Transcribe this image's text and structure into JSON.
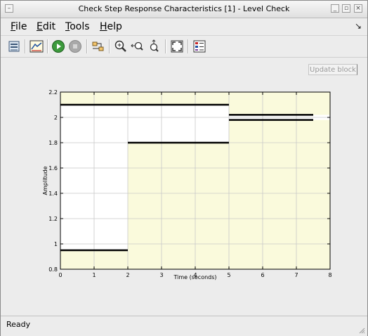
{
  "window": {
    "title": "Check Step Response Characteristics [1] - Level Check"
  },
  "menu": {
    "items": [
      {
        "label": "File",
        "mnemonic": "F",
        "rest": "ile"
      },
      {
        "label": "Edit",
        "mnemonic": "E",
        "rest": "dit"
      },
      {
        "label": "Tools",
        "mnemonic": "T",
        "rest": "ools"
      },
      {
        "label": "Help",
        "mnemonic": "H",
        "rest": "elp"
      }
    ],
    "dock_arrow": "↘"
  },
  "toolbar": {
    "icons": [
      "block-parameters-icon",
      "response-optimization-icon",
      "start-simulation-icon",
      "stop-simulation-icon",
      "show-plant-icon",
      "zoom-in-icon",
      "zoom-x-icon",
      "zoom-y-icon",
      "fit-to-view-icon",
      "legend-icon"
    ]
  },
  "update_button": {
    "label": "Update block"
  },
  "status": {
    "text": "Ready"
  },
  "chart_data": {
    "type": "line",
    "xlabel": "Time (seconds)",
    "ylabel": "Amplitude",
    "xlim": [
      0,
      8
    ],
    "ylim": [
      0.8,
      2.2
    ],
    "xticks": [
      0,
      1,
      2,
      3,
      4,
      5,
      6,
      7,
      8
    ],
    "yticks": [
      0.8,
      1,
      1.2,
      1.4,
      1.6,
      1.8,
      2,
      2.2
    ],
    "ytick_labels": [
      "0.8",
      "1",
      "1.2",
      "1.4",
      "1.6",
      "1.8",
      "2",
      "2.2"
    ],
    "grid": true,
    "colors": {
      "constraint_fill": "#fafadc",
      "feasible": "#ffffff",
      "bounds": "#000000",
      "grid": "#c8c8c8"
    },
    "upper_bounds": [
      {
        "x": [
          0,
          5
        ],
        "y": 2.1
      },
      {
        "x": [
          5,
          7.5
        ],
        "y": 2.02
      }
    ],
    "lower_bounds": [
      {
        "x": [
          0,
          2
        ],
        "y": 0.95
      },
      {
        "x": [
          2,
          5
        ],
        "y": 1.8
      },
      {
        "x": [
          5,
          7.5
        ],
        "y": 1.98
      }
    ]
  }
}
